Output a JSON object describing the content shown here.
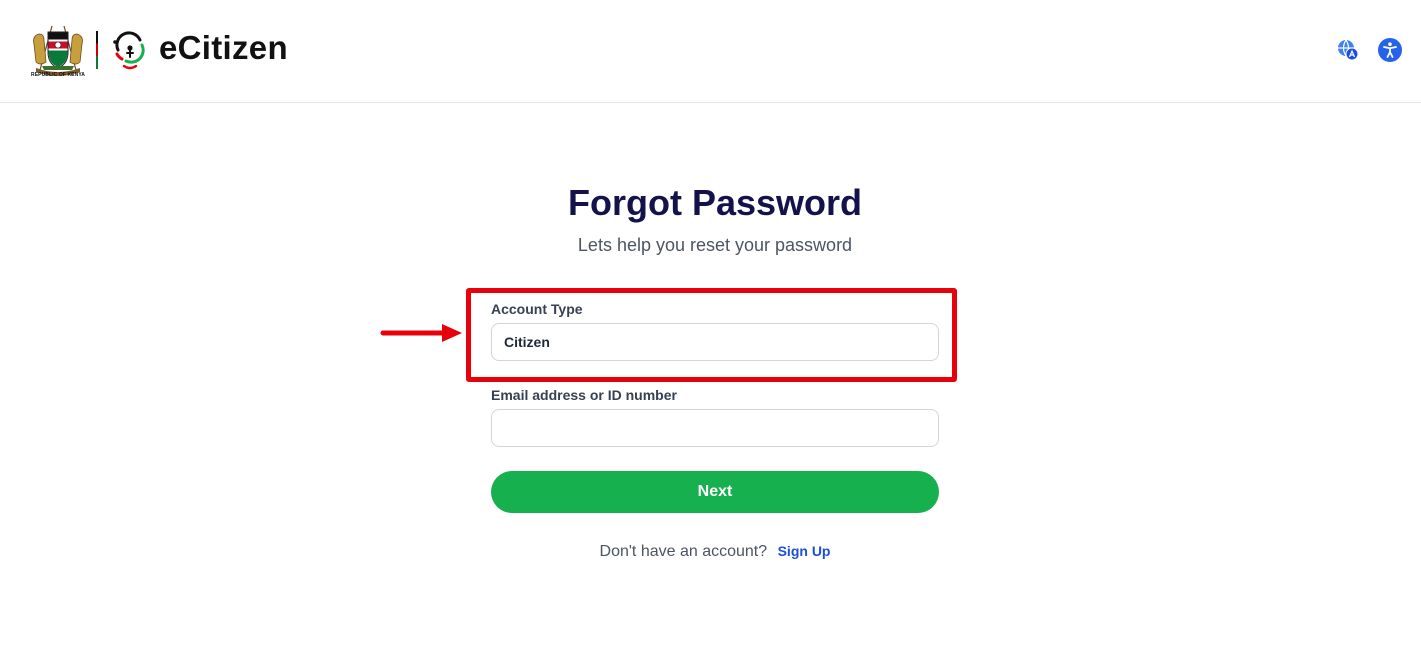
{
  "header": {
    "coat_caption": "REPUBLIC OF KENYA",
    "brand_name": "eCitizen",
    "icons": {
      "translate": "translate-icon",
      "accessibility": "accessibility-icon"
    }
  },
  "main": {
    "title": "Forgot Password",
    "subtitle": "Lets help you reset your password",
    "account_type": {
      "label": "Account Type",
      "value": "Citizen"
    },
    "email": {
      "label": "Email address or ID number",
      "value": "",
      "placeholder": ""
    },
    "next_button": "Next",
    "signup_prompt": "Don't have an account?",
    "signup_link": "Sign Up"
  },
  "colors": {
    "brand_green": "#16b04f",
    "title_navy": "#14124a",
    "link_blue": "#1d4ed8",
    "annotation_red": "#e8000b",
    "icon_blue": "#2563eb"
  }
}
